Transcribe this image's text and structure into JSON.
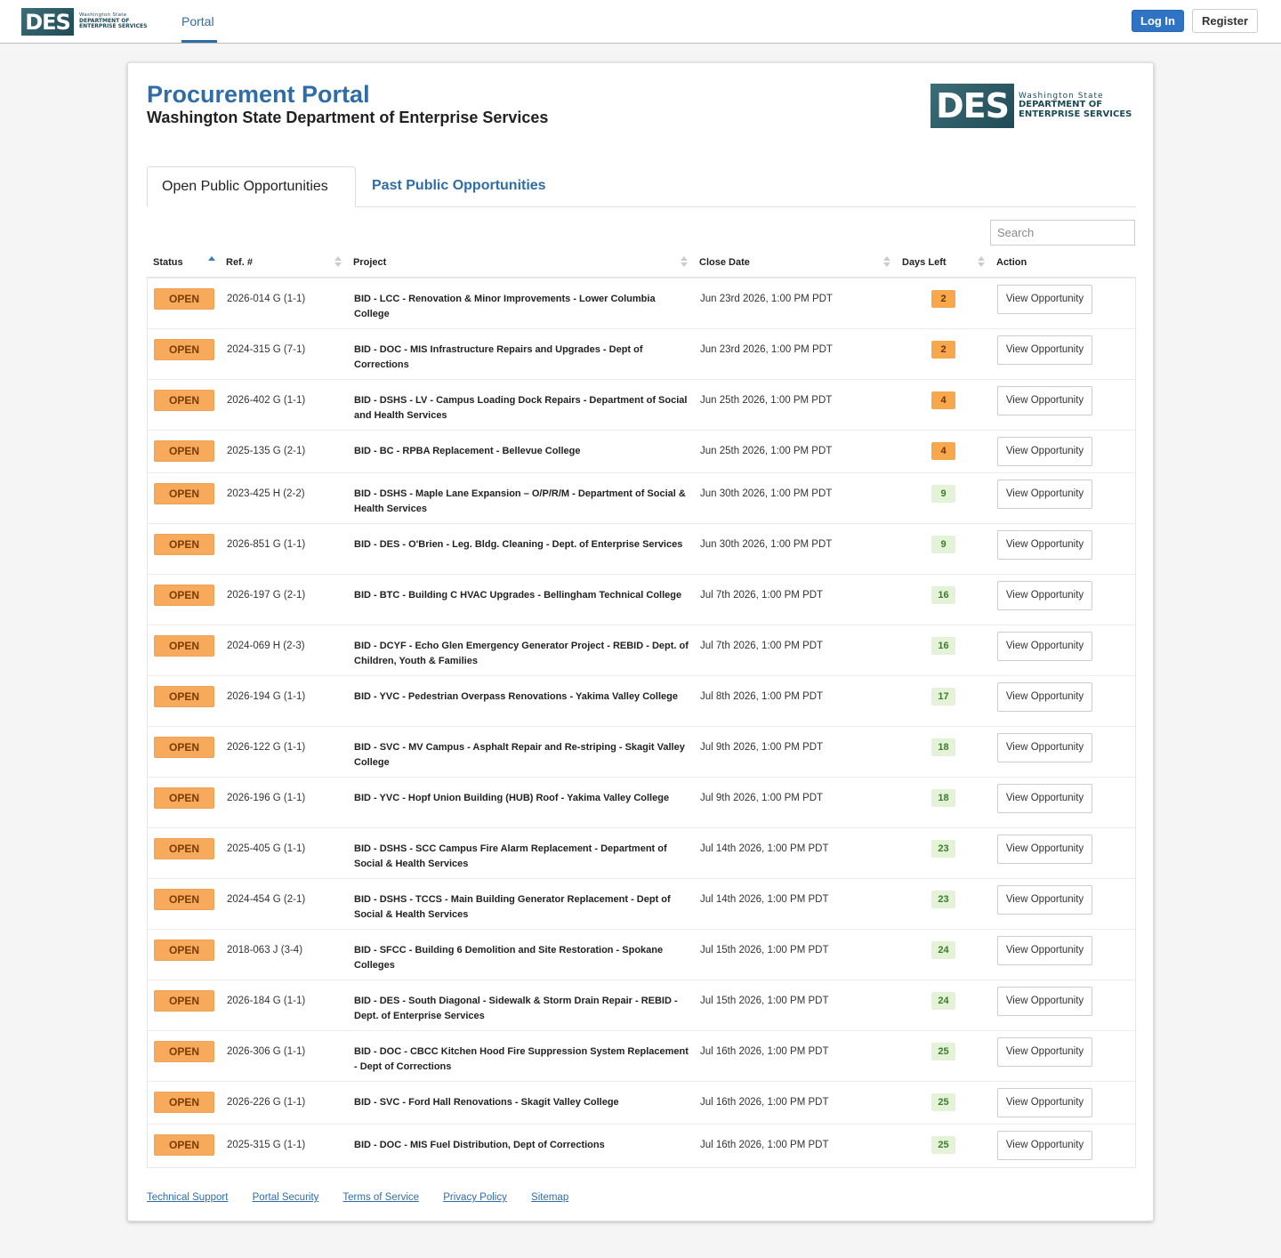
{
  "nav": {
    "logo_abbr": "DES",
    "logo_line1": "Washington State",
    "logo_line2": "DEPARTMENT OF",
    "logo_line3": "ENTERPRISE SERVICES",
    "portal_label": "Portal",
    "login_label": "Log In",
    "register_label": "Register"
  },
  "header": {
    "title": "Procurement Portal",
    "subtitle": "Washington State Department of Enterprise Services"
  },
  "tabs": [
    {
      "label": "Open Public Opportunities",
      "active": true
    },
    {
      "label": "Past Public Opportunities",
      "active": false
    }
  ],
  "search": {
    "placeholder": "Search",
    "value": ""
  },
  "table": {
    "columns": [
      "Status",
      "Ref. #",
      "Project",
      "Close Date",
      "Days Left",
      "Action"
    ],
    "sorted_column": "Status",
    "rows": [
      {
        "status": "OPEN",
        "ref": "2026-014 G (1-1)",
        "project": "BID - LCC - Renovation & Minor Improvements - Lower Columbia College",
        "close": "Jun 23rd 2026, 1:00 PM PDT",
        "days": "2",
        "urgent": true,
        "action": "View Opportunity"
      },
      {
        "status": "OPEN",
        "ref": "2024-315 G (7-1)",
        "project": "BID - DOC - MIS Infrastructure Repairs and Upgrades - Dept of Corrections",
        "close": "Jun 23rd 2026, 1:00 PM PDT",
        "days": "2",
        "urgent": true,
        "action": "View Opportunity"
      },
      {
        "status": "OPEN",
        "ref": "2026-402 G (1-1)",
        "project": "BID - DSHS - LV - Campus Loading Dock Repairs - Department of Social and Health Services",
        "close": "Jun 25th 2026, 1:00 PM PDT",
        "days": "4",
        "urgent": true,
        "action": "View Opportunity"
      },
      {
        "status": "OPEN",
        "ref": "2025-135 G (2-1)",
        "project": "BID - BC - RPBA Replacement - Bellevue College",
        "close": "Jun 25th 2026, 1:00 PM PDT",
        "days": "4",
        "urgent": true,
        "action": "View Opportunity"
      },
      {
        "status": "OPEN",
        "ref": "2023-425 H (2-2)",
        "project": "BID - DSHS - Maple Lane Expansion – O/P/R/M - Department of Social & Health Services",
        "close": "Jun 30th 2026, 1:00 PM PDT",
        "days": "9",
        "urgent": false,
        "action": "View Opportunity"
      },
      {
        "status": "OPEN",
        "ref": "2026-851 G (1-1)",
        "project": "BID - DES - O'Brien - Leg. Bldg. Cleaning - Dept. of Enterprise Services",
        "close": "Jun 30th 2026, 1:00 PM PDT",
        "days": "9",
        "urgent": false,
        "action": "View Opportunity"
      },
      {
        "status": "OPEN",
        "ref": "2026-197 G (2-1)",
        "project": "BID - BTC - Building C HVAC Upgrades - Bellingham Technical College",
        "close": "Jul 7th 2026, 1:00 PM PDT",
        "days": "16",
        "urgent": false,
        "action": "View Opportunity"
      },
      {
        "status": "OPEN",
        "ref": "2024-069 H (2-3)",
        "project": "BID - DCYF - Echo Glen Emergency Generator Project - REBID - Dept. of Children, Youth & Families",
        "close": "Jul 7th 2026, 1:00 PM PDT",
        "days": "16",
        "urgent": false,
        "action": "View Opportunity"
      },
      {
        "status": "OPEN",
        "ref": "2026-194 G (1-1)",
        "project": "BID - YVC - Pedestrian Overpass Renovations - Yakima Valley College",
        "close": "Jul 8th 2026, 1:00 PM PDT",
        "days": "17",
        "urgent": false,
        "action": "View Opportunity"
      },
      {
        "status": "OPEN",
        "ref": "2026-122 G (1-1)",
        "project": "BID - SVC - MV Campus - Asphalt Repair and Re-striping - Skagit Valley College",
        "close": "Jul 9th 2026, 1:00 PM PDT",
        "days": "18",
        "urgent": false,
        "action": "View Opportunity"
      },
      {
        "status": "OPEN",
        "ref": "2026-196 G (1-1)",
        "project": "BID - YVC - Hopf Union Building (HUB) Roof - Yakima Valley College",
        "close": "Jul 9th 2026, 1:00 PM PDT",
        "days": "18",
        "urgent": false,
        "action": "View Opportunity"
      },
      {
        "status": "OPEN",
        "ref": "2025-405 G (1-1)",
        "project": "BID - DSHS - SCC Campus Fire Alarm Replacement - Department of Social & Health Services",
        "close": "Jul 14th 2026, 1:00 PM PDT",
        "days": "23",
        "urgent": false,
        "action": "View Opportunity"
      },
      {
        "status": "OPEN",
        "ref": "2024-454 G (2-1)",
        "project": "BID - DSHS - TCCS - Main Building Generator Replacement - Dept of Social & Health Services",
        "close": "Jul 14th 2026, 1:00 PM PDT",
        "days": "23",
        "urgent": false,
        "action": "View Opportunity"
      },
      {
        "status": "OPEN",
        "ref": "2018-063 J (3-4)",
        "project": "BID - SFCC - Building 6 Demolition and Site Restoration - Spokane Colleges",
        "close": "Jul 15th 2026, 1:00 PM PDT",
        "days": "24",
        "urgent": false,
        "action": "View Opportunity"
      },
      {
        "status": "OPEN",
        "ref": "2026-184 G (1-1)",
        "project": "BID - DES - South Diagonal - Sidewalk & Storm Drain Repair - REBID - Dept. of Enterprise Services",
        "close": "Jul 15th 2026, 1:00 PM PDT",
        "days": "24",
        "urgent": false,
        "action": "View Opportunity"
      },
      {
        "status": "OPEN",
        "ref": "2026-306 G (1-1)",
        "project": "BID - DOC - CBCC Kitchen Hood Fire Suppression System Replacement - Dept of Corrections",
        "close": "Jul 16th 2026, 1:00 PM PDT",
        "days": "25",
        "urgent": false,
        "action": "View Opportunity"
      },
      {
        "status": "OPEN",
        "ref": "2026-226 G (1-1)",
        "project": "BID - SVC - Ford Hall Renovations - Skagit Valley College",
        "close": "Jul 16th 2026, 1:00 PM PDT",
        "days": "25",
        "urgent": false,
        "action": "View Opportunity"
      },
      {
        "status": "OPEN",
        "ref": "2025-315 G (1-1)",
        "project": "BID - DOC - MIS Fuel Distribution, Dept of Corrections",
        "close": "Jul 16th 2026, 1:00 PM PDT",
        "days": "25",
        "urgent": false,
        "action": "View Opportunity"
      }
    ]
  },
  "footer": {
    "links": [
      "Technical Support",
      "Portal Security",
      "Terms of Service",
      "Privacy Policy",
      "Sitemap"
    ]
  },
  "colors": {
    "brand_blue": "#2f6da8",
    "status_open": "#f7aa5b",
    "days_urgent": "#f7a74c",
    "days_normal": "#e4f2d7"
  }
}
